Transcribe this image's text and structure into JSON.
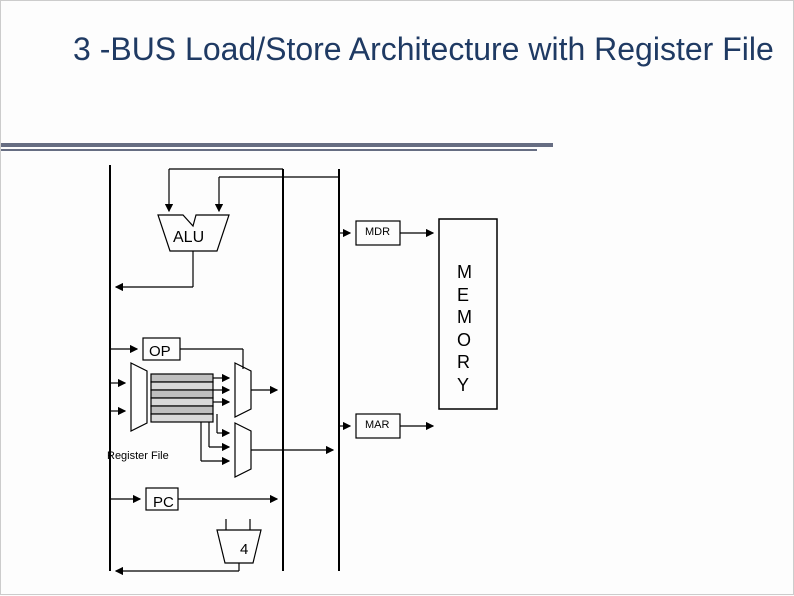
{
  "title": "3 -BUS Load/Store Architecture with Register File",
  "blocks": {
    "alu": "ALU",
    "mdr": "MDR",
    "op": "OP",
    "mar": "MAR",
    "register_file": "Register File",
    "pc": "PC",
    "increment_const": "4",
    "memory_lines": [
      "M",
      "E",
      "M",
      "O",
      "R",
      "Y"
    ]
  }
}
